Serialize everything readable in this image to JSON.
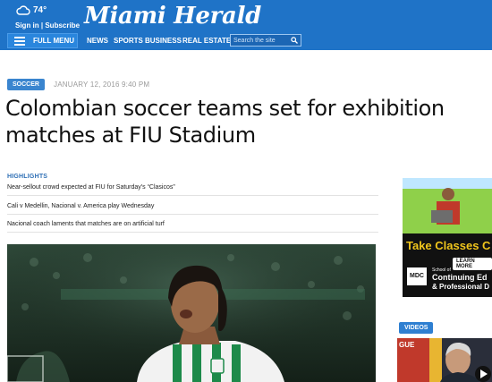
{
  "header": {
    "temperature": "74°",
    "signin": "Sign in | Subscribe",
    "logo": "Miami Herald",
    "full_menu": "FULL MENU",
    "nav": [
      "NEWS",
      "SPORTS",
      "BUSINESS",
      "REAL ESTATE"
    ],
    "search_placeholder": "Search the site",
    "bar_color": "#1f73c7"
  },
  "article": {
    "section": "SOCCER",
    "date": "JANUARY 12, 2016 9:40 PM",
    "headline": "Colombian soccer teams set for exhibition matches at FIU Stadium",
    "highlights_title": "HIGHLIGHTS",
    "highlights": [
      "Near-sellout crowd expected at FIU for Saturday's “Clasicos”",
      "Cali v Medellin, Nacional v. America play Wednesday",
      "Nacional coach laments that matches are on artificial turf"
    ],
    "accent_color": "#3a85cf"
  },
  "sidebar": {
    "ad": {
      "line1": "Take Classes C",
      "learn_more": "LEARN MORE",
      "school": "School of",
      "program_1": "Continuing Ed",
      "program_2": "& Professional D",
      "logo_text": "MDC"
    },
    "videos_label": "VIDEOS",
    "video_thumb_text": "GUE"
  }
}
